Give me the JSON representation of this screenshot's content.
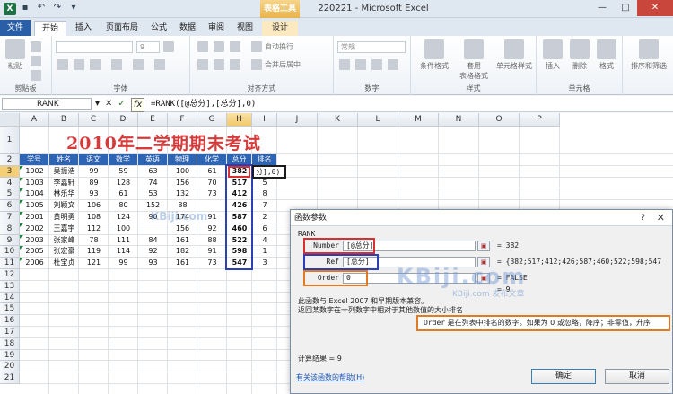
{
  "window": {
    "title": "220221 - Microsoft Excel",
    "context_tab_title": "表格工具",
    "controls": [
      "—",
      "□",
      "✕"
    ]
  },
  "tabs": [
    {
      "label": "文件",
      "type": "file"
    },
    {
      "label": "开始",
      "type": "active"
    },
    {
      "label": "插入"
    },
    {
      "label": "页面布局"
    },
    {
      "label": "公式"
    },
    {
      "label": "数据"
    },
    {
      "label": "审阅"
    },
    {
      "label": "视图"
    },
    {
      "label": "设计",
      "type": "context"
    }
  ],
  "ribbon": {
    "groups": [
      "剪贴板",
      "字体",
      "对齐方式",
      "数字",
      "样式",
      "单元格"
    ],
    "paste": "粘贴",
    "font_size": "9",
    "wrap_text": "自动换行",
    "merge_center": "合并后居中",
    "number_format": "常规",
    "cond_format": "条件格式",
    "table_format": "套用",
    "table_format2": "表格格式",
    "cell_style": "单元格样式",
    "insert": "插入",
    "delete": "删除",
    "format": "格式",
    "sort_filter": "排序和筛选"
  },
  "formula_bar": {
    "name_box": "RANK",
    "formula": "=RANK([@总分],[总分],0)",
    "fx": "fx"
  },
  "sheet": {
    "columns": [
      "A",
      "B",
      "C",
      "D",
      "E",
      "F",
      "G",
      "H",
      "I",
      "J",
      "K",
      "L",
      "M",
      "N",
      "O",
      "P"
    ],
    "rows": [
      "1",
      "2",
      "3",
      "4",
      "5",
      "6",
      "7",
      "8",
      "9",
      "10",
      "11",
      "12",
      "13",
      "14",
      "15",
      "16",
      "17",
      "18",
      "19",
      "20",
      "21"
    ],
    "title": "2010年二学期期末考试",
    "headers": [
      "学号",
      "姓名",
      "语文",
      "数学",
      "英语",
      "物理",
      "化学",
      "总分",
      "排名"
    ],
    "records": [
      [
        "1002",
        "吴振浩",
        "99",
        "59",
        "63",
        "100",
        "61",
        "382",
        ""
      ],
      [
        "1003",
        "李嘉轩",
        "89",
        "128",
        "74",
        "156",
        "70",
        "517",
        "5"
      ],
      [
        "1004",
        "林乐华",
        "93",
        "61",
        "53",
        "132",
        "73",
        "412",
        "8"
      ],
      [
        "1005",
        "刘颖文",
        "106",
        "80",
        "152",
        "88",
        "",
        "426",
        "7"
      ],
      [
        "2001",
        "黄明勇",
        "108",
        "124",
        "90",
        "174",
        "91",
        "587",
        "2"
      ],
      [
        "2002",
        "王嘉宇",
        "112",
        "100",
        "",
        "156",
        "92",
        "460",
        "6"
      ],
      [
        "2003",
        "张家峰",
        "78",
        "111",
        "84",
        "161",
        "88",
        "522",
        "4"
      ],
      [
        "2005",
        "张宏豪",
        "119",
        "114",
        "92",
        "182",
        "91",
        "598",
        "1"
      ],
      [
        "2006",
        "杜宝贞",
        "121",
        "99",
        "93",
        "161",
        "73",
        "547",
        "3"
      ]
    ],
    "active_cell_text": "分],0)",
    "watermark": "KBiji.com"
  },
  "dialog": {
    "title": "函数参数",
    "help_mark": "?",
    "close": "✕",
    "function": "RANK",
    "args": [
      {
        "label": "Number",
        "value": "[@总分]",
        "result": "= 382"
      },
      {
        "label": "Ref",
        "value": "[总分]",
        "result": "= {382;517;412;426;587;460;522;598;547"
      },
      {
        "label": "Order",
        "value": "0",
        "result": "= FALSE"
      }
    ],
    "extra_result": "= 9",
    "desc1": "此函数与 Excel 2007 和早期版本兼容。",
    "desc2": "返回某数字在一列数字中相对于其他数值的大小排名",
    "order_label": "Order",
    "order_desc": "是在列表中排名的数字。如果为 0 或忽略，降序；非零值，升序",
    "calc_result": "计算结果 =  9",
    "help_link": "有关该函数的帮助(H)",
    "ok": "确定",
    "cancel": "取消",
    "watermark": "KBiji.com",
    "watermark_sub": "KBiji.com 发布文章"
  }
}
